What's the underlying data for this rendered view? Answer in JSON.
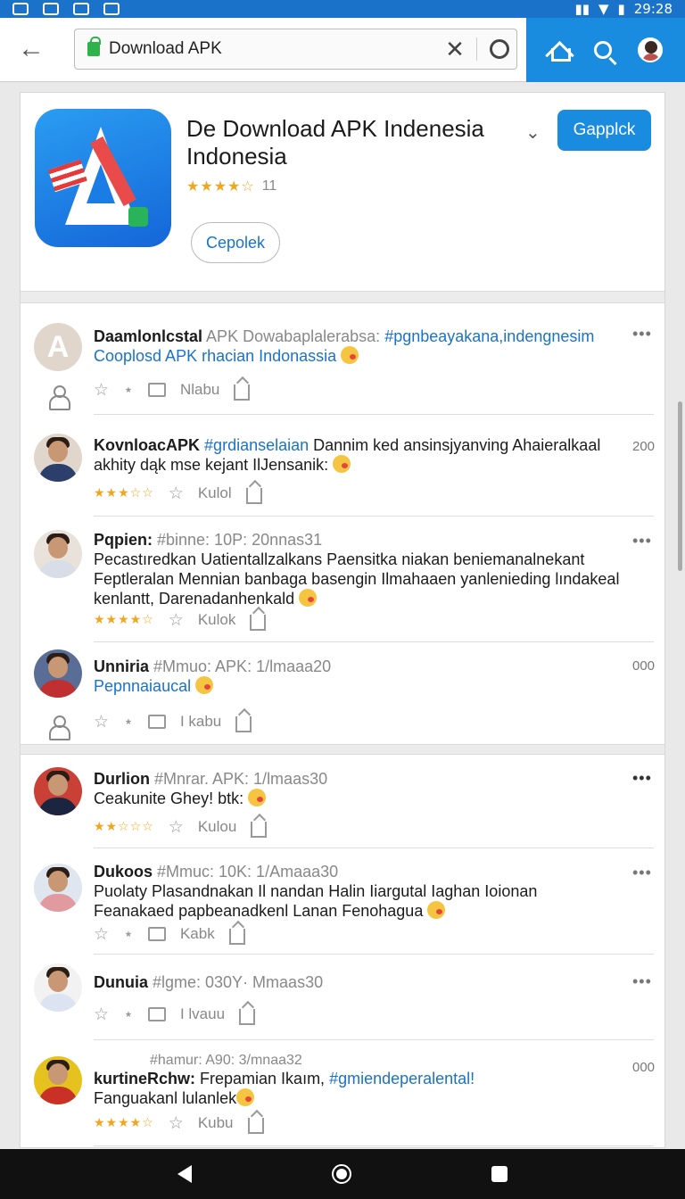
{
  "status_bar": {
    "time": "29:28"
  },
  "browser": {
    "url_text": "Download APK"
  },
  "app": {
    "title": "De Download APK Indenesia Indonesia",
    "stars": "★★★★☆",
    "rating_count": "11",
    "primary_button": "Gapplck",
    "secondary_button": "Cepolek"
  },
  "posts": [
    {
      "author": "Daamlonlcstal",
      "body_prefix": " APK Dowabaplalerabsa: ",
      "hashtag": "#pgnbeayakana,indengnesim",
      "body_line2": "Cooplosd APK rhacian Indonassia",
      "action_label": "Nlabu"
    },
    {
      "author": "KovnloacAPK",
      "hashtag": "#grdianselaian",
      "body": " Dannim ked ansinsjyanving Ahaieralkaal akhity dąk mse kejant IlJensanik:",
      "count": "200",
      "stars": "★★★☆☆",
      "action_label": "Kulol"
    },
    {
      "author": "Pqpien:",
      "meta": " #binne: 10P: 20nnas31",
      "body": "Pecastıredkan Uatientallzalkans Paensitka niakan beniemanalnekant Feptleralan Mennian banbaga basengin Ilmahaaen yanlenieding lındakeal kenlantt, Darenadanhenkald",
      "stars": "★★★★☆",
      "action_label": "Kulok"
    },
    {
      "author": "Unniria",
      "meta": " #Mmuo: APK: 1/lmaaa20",
      "body": "Pepnnaiaucal",
      "count": "000",
      "action_label": "I kabu"
    },
    {
      "author": "Durlion",
      "meta": " #Mnrar. APK: 1/lmaas30",
      "body": "Ceakunite Ghey! btk:",
      "stars": "★★☆☆☆",
      "action_label": "Kulou"
    },
    {
      "author": "Dukoos",
      "meta": " #Mmuc: 10K: 1/Amaaa30",
      "body": "Puolaty Plasandnakan Il nandan Halin Iiargutal Iaghan Ioionan Feanakaed papbeanadkenl Lanan Fenohagua",
      "action_label": "Kabk"
    },
    {
      "author": "Dunuia",
      "meta": " #lgme: 030Y· Mmaas30",
      "action_label": "I lvauu"
    },
    {
      "meta_line": "#hamur: A90: 3/mnaa32",
      "author": "kurtineRchw:",
      "body": " Frepamian Ikaım, ",
      "hashtag": "#gmiendeperalental!",
      "body_line2": "Fanguakanl lulanlek",
      "count": "000",
      "stars": "★★★★☆",
      "action_label": "Kubu"
    }
  ],
  "icons": {
    "more": "•••",
    "star_outline": "☆",
    "small_star": "⋆"
  }
}
